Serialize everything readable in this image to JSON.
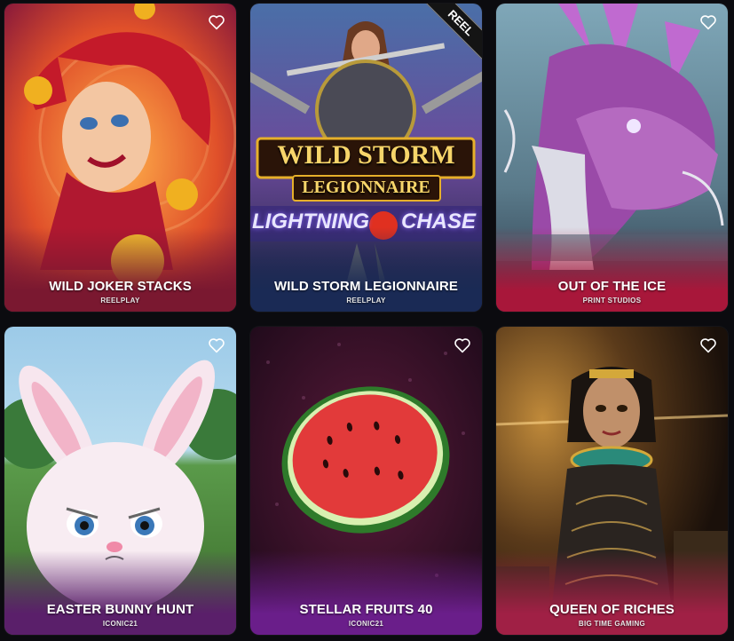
{
  "games": [
    {
      "title": "WILD JOKER STACKS",
      "provider": "REELPLAY"
    },
    {
      "title": "WILD STORM LEGIONNAIRE",
      "provider": "REELPLAY",
      "logo_line1": "WILD STORM",
      "logo_line2": "LEGIONNAIRE",
      "logo_line3": "LIGHTNING",
      "logo_line4": "CHASE",
      "corner_badge": "REEL"
    },
    {
      "title": "OUT OF THE ICE",
      "provider": "PRINT STUDIOS"
    },
    {
      "title": "EASTER BUNNY HUNT",
      "provider": "ICONIC21"
    },
    {
      "title": "STELLAR FRUITS 40",
      "provider": "ICONIC21"
    },
    {
      "title": "QUEEN OF RICHES",
      "provider": "BIG TIME GAMING"
    }
  ],
  "icons": {
    "favorite": "heart-outline-icon"
  },
  "colors": {
    "page_background": "#0b0b0f",
    "caption_text": "#ffffff",
    "heart_outline": "#ffffff",
    "card1_fade": "#7a1830",
    "card2_fade": "#1a2a55",
    "card3_fade": "#a8173a",
    "card4_fade": "#5a1f6a",
    "card5_fade": "#6a1e8a",
    "card6_fade": "#a02045"
  }
}
